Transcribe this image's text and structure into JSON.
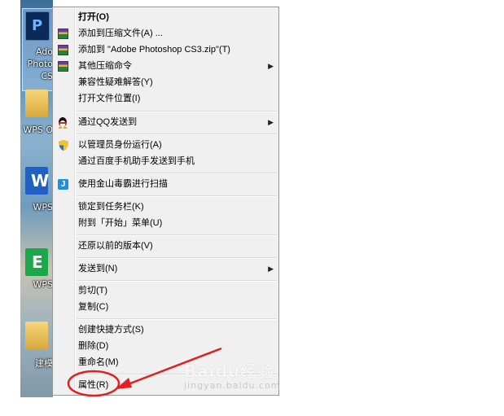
{
  "desktop": {
    "icons": [
      {
        "name": "photoshop",
        "glyph": "P",
        "label_lines": [
          "Ado",
          "Photo",
          "CS"
        ]
      },
      {
        "name": "folder",
        "label_lines": [
          "WPS O"
        ]
      },
      {
        "name": "wps-writer",
        "glyph": "W",
        "label_lines": [
          "WPS"
        ]
      },
      {
        "name": "wps-spreadsheet",
        "glyph": "E",
        "label_lines": [
          "WPS"
        ]
      },
      {
        "name": "folder",
        "label_lines": [
          "建模"
        ]
      }
    ]
  },
  "menu": {
    "items": [
      {
        "label": "打开(O)",
        "bold": true
      },
      {
        "label": "添加到压缩文件(A) ...",
        "icon": "winrar-icon"
      },
      {
        "label": "添加到 \"Adobe Photoshop CS3.zip\"(T)",
        "icon": "winrar-icon"
      },
      {
        "label": "其他压缩命令",
        "icon": "winrar-icon",
        "submenu": true
      },
      {
        "label": "兼容性疑难解答(Y)"
      },
      {
        "label": "打开文件位置(I)"
      },
      {
        "label": "通过QQ发送到",
        "icon": "qq-penguin-icon",
        "submenu": true
      },
      {
        "label": "以管理员身份运行(A)",
        "icon": "uac-shield-icon"
      },
      {
        "label": "通过百度手机助手发送到手机"
      },
      {
        "label": "使用金山毒霸进行扫描",
        "icon": "kingsoft-antivirus-icon"
      },
      {
        "label": "锁定到任务栏(K)"
      },
      {
        "label": "附到「开始」菜单(U)"
      },
      {
        "label": "还原以前的版本(V)"
      },
      {
        "label": "发送到(N)",
        "submenu": true
      },
      {
        "label": "剪切(T)"
      },
      {
        "label": "复制(C)"
      },
      {
        "label": "创建快捷方式(S)"
      },
      {
        "label": "删除(D)"
      },
      {
        "label": "重命名(M)"
      },
      {
        "label": "属性(R)",
        "highlighted_by_annotation": true
      }
    ],
    "submenu_arrow": "▶"
  },
  "annotation": {
    "color": "#e02020",
    "target": "属性(R)"
  },
  "watermark": {
    "text": "Baidu经验",
    "subtext": "jingyan.baidu.com"
  }
}
